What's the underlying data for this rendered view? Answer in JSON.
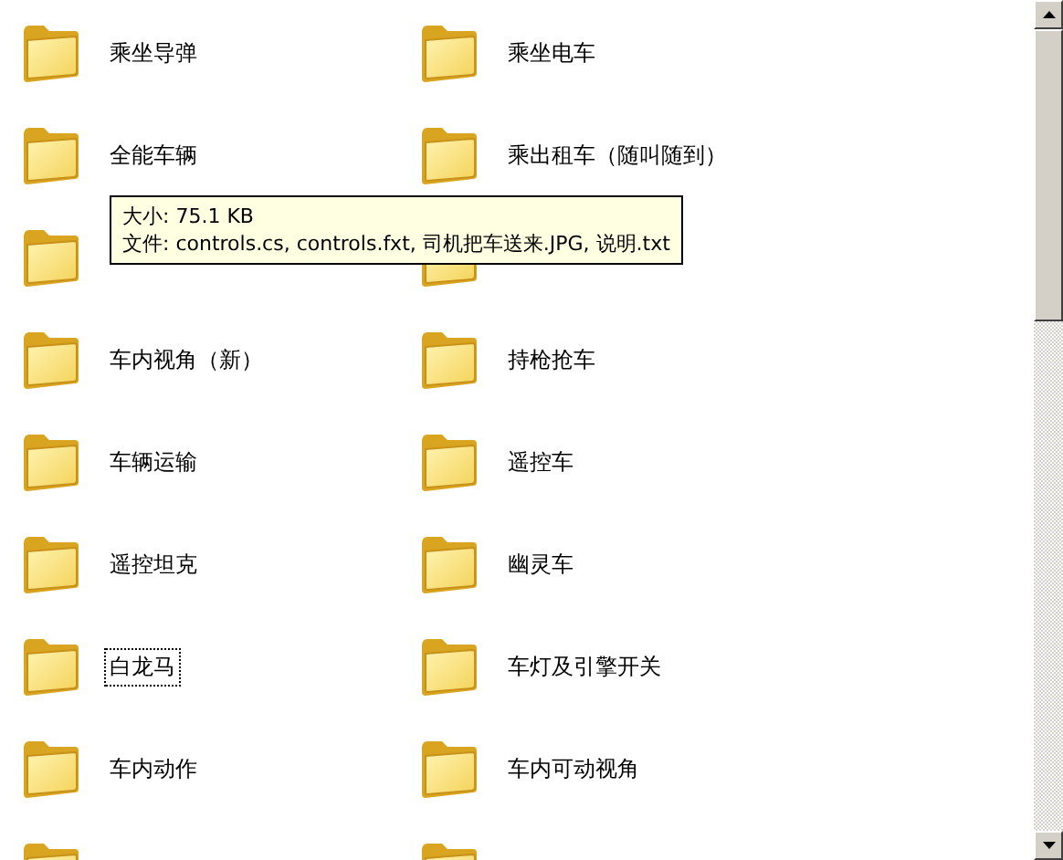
{
  "folders": [
    {
      "kind": "named",
      "label": "乘坐导弹",
      "focused": false
    },
    {
      "kind": "named",
      "label": "乘坐电车",
      "focused": false
    },
    {
      "kind": "named",
      "label": "全能车辆",
      "focused": false
    },
    {
      "kind": "named",
      "label": "乘出租车（随叫随到）",
      "focused": false
    },
    {
      "kind": "covered"
    },
    {
      "kind": "covered"
    },
    {
      "kind": "named",
      "label": "车内视角（新）",
      "focused": false
    },
    {
      "kind": "named",
      "label": "持枪抢车",
      "focused": false
    },
    {
      "kind": "named",
      "label": "车辆运输",
      "focused": false
    },
    {
      "kind": "named",
      "label": "遥控车",
      "focused": false
    },
    {
      "kind": "named",
      "label": "遥控坦克",
      "focused": false
    },
    {
      "kind": "named",
      "label": "幽灵车",
      "focused": false
    },
    {
      "kind": "named",
      "label": "白龙马",
      "focused": true
    },
    {
      "kind": "named",
      "label": "车灯及引擎开关",
      "focused": false
    },
    {
      "kind": "named",
      "label": "车内动作",
      "focused": false
    },
    {
      "kind": "named",
      "label": "车内可动视角",
      "focused": false
    },
    {
      "kind": "covered"
    },
    {
      "kind": "covered"
    }
  ],
  "tooltip": {
    "lines": [
      "大小: 75.1 KB",
      "文件: controls.cs, controls.fxt, 司机把车送来.JPG, 说明.txt"
    ]
  }
}
